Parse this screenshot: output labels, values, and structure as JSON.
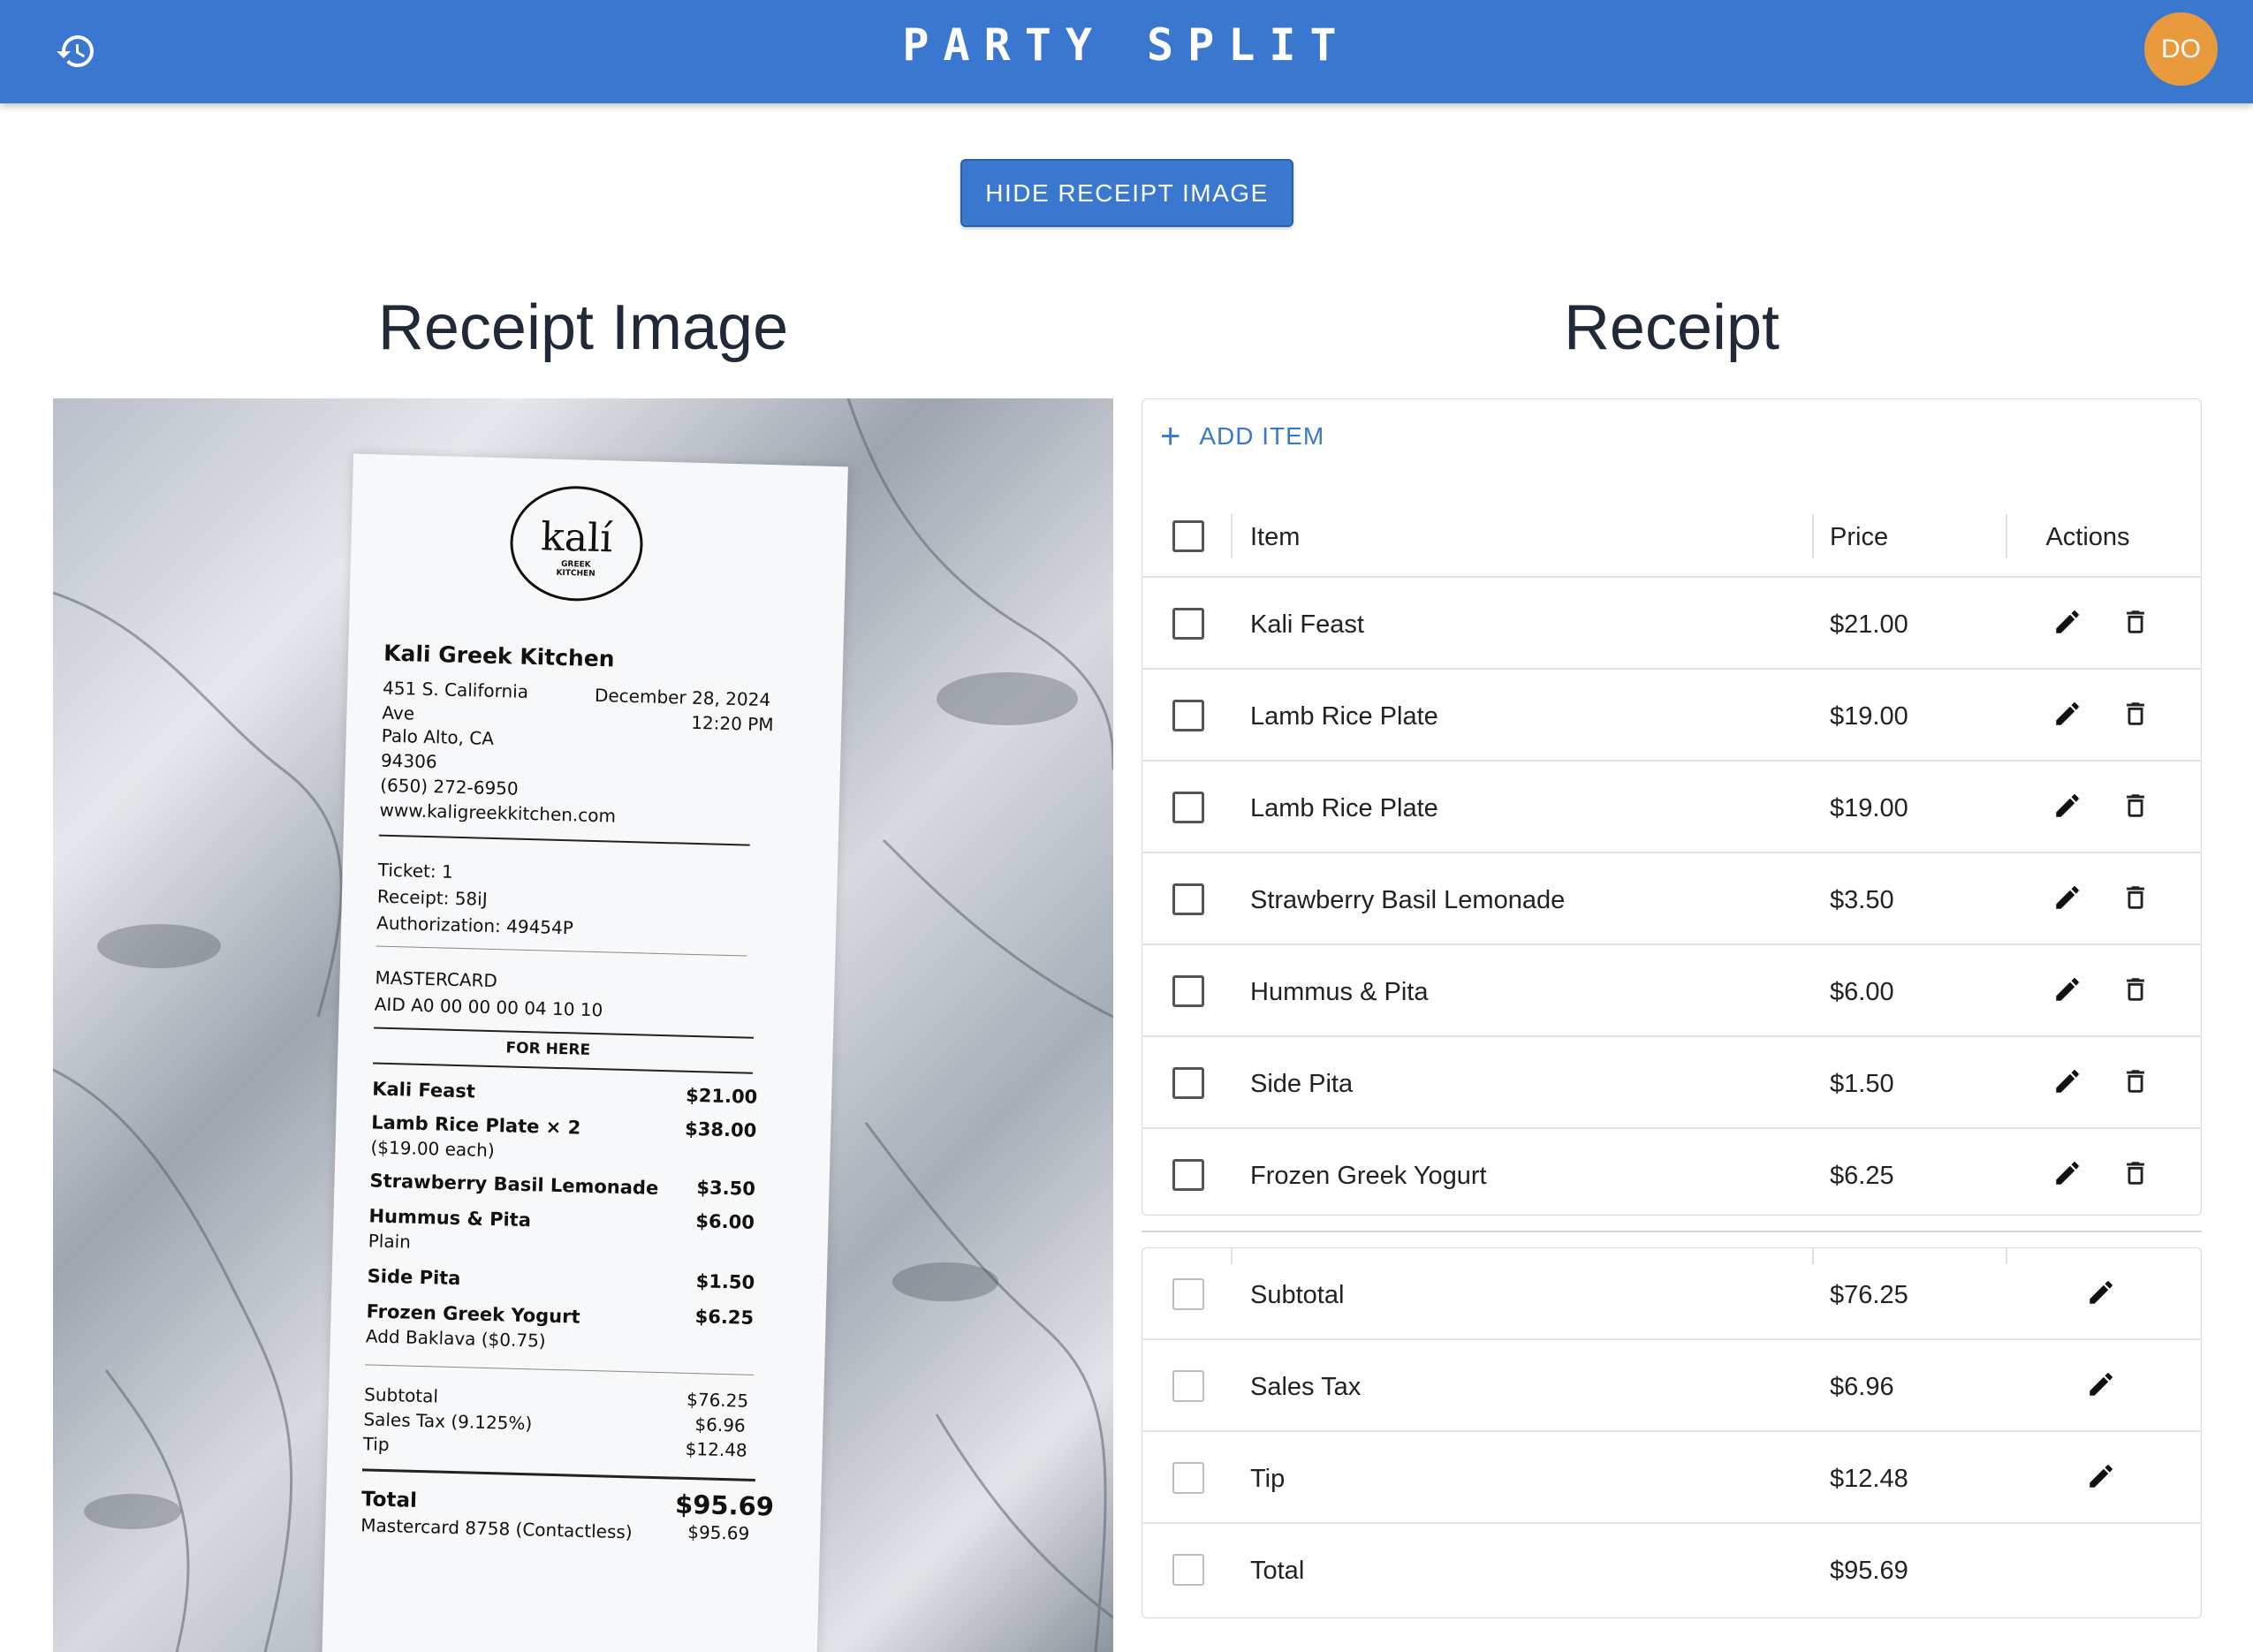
{
  "app": {
    "title": "PARTY SPLIT",
    "avatar_initials": "DO",
    "history_icon": "history-icon"
  },
  "toggle_button": {
    "label": "HIDE RECEIPT IMAGE"
  },
  "headings": {
    "image": "Receipt Image",
    "receipt": "Receipt"
  },
  "receipt_photo": {
    "logo_word": "kalí",
    "logo_sub1": "GREEK",
    "logo_sub2": "KITCHEN",
    "restaurant": "Kali Greek Kitchen",
    "address1": "451 S. California",
    "address2": "Ave",
    "address3": "Palo Alto, CA",
    "address4": "94306",
    "phone": "(650) 272-6950",
    "website": "www.kaligreekkitchen.com",
    "date": "December 28, 2024",
    "time": "12:20 PM",
    "ticket": "Ticket: 1",
    "receipt_no": "Receipt: 58iJ",
    "authorization": "Authorization: 49454P",
    "card": "MASTERCARD",
    "aid": "AID A0 00 00 00 04 10 10",
    "for_here": "FOR HERE",
    "items": [
      {
        "name": "Kali Feast",
        "price": "$21.00"
      },
      {
        "name": "Lamb Rice Plate × 2",
        "note": "($19.00 each)",
        "price": "$38.00"
      },
      {
        "name": "Strawberry Basil Lemonade",
        "price": "$3.50"
      },
      {
        "name": "Hummus & Pita",
        "note": "Plain",
        "price": "$6.00"
      },
      {
        "name": "Side Pita",
        "price": "$1.50"
      },
      {
        "name": "Frozen Greek Yogurt",
        "note": "Add Baklava ($0.75)",
        "price": "$6.25"
      }
    ],
    "subtotal_label": "Subtotal",
    "subtotal": "$76.25",
    "tax_label": "Sales Tax (9.125%)",
    "tax": "$6.96",
    "tip_label": "Tip",
    "tip": "$12.48",
    "total_label": "Total",
    "total": "$95.69",
    "payment_label": "Mastercard 8758 (Contactless)",
    "payment": "$95.69"
  },
  "table": {
    "add_item_label": "ADD ITEM",
    "columns": {
      "item": "Item",
      "price": "Price",
      "actions": "Actions"
    },
    "rows": [
      {
        "item": "Kali Feast",
        "price": "$21.00"
      },
      {
        "item": "Lamb Rice Plate",
        "price": "$19.00"
      },
      {
        "item": "Lamb Rice Plate",
        "price": "$19.00"
      },
      {
        "item": "Strawberry Basil Lemonade",
        "price": "$3.50"
      },
      {
        "item": "Hummus & Pita",
        "price": "$6.00"
      },
      {
        "item": "Side Pita",
        "price": "$1.50"
      },
      {
        "item": "Frozen Greek Yogurt",
        "price": "$6.25"
      }
    ],
    "totals": [
      {
        "item": "Subtotal",
        "price": "$76.25",
        "editable": true
      },
      {
        "item": "Sales Tax",
        "price": "$6.96",
        "editable": true
      },
      {
        "item": "Tip",
        "price": "$12.48",
        "editable": true
      },
      {
        "item": "Total",
        "price": "$95.69",
        "editable": false
      }
    ]
  },
  "colors": {
    "appbar": "#3a78cf",
    "avatar": "#e99a3c",
    "accent": "#3a78cf"
  }
}
